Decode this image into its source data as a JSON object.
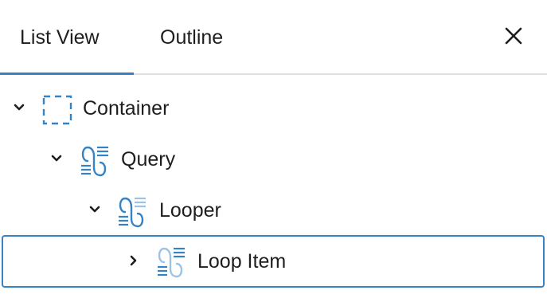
{
  "tabs": [
    {
      "label": "List View",
      "active": true
    },
    {
      "label": "Outline",
      "active": false
    }
  ],
  "colors": {
    "accent": "#3582c4",
    "icon_light": "#9ec2e6",
    "text": "#1e1e1e",
    "divider": "#e0e0e0"
  },
  "tree": [
    {
      "label": "Container",
      "icon": "container-icon",
      "expanded": true,
      "selected": false
    },
    {
      "label": "Query",
      "icon": "query-loop-icon",
      "expanded": true,
      "selected": false
    },
    {
      "label": "Looper",
      "icon": "query-loop-icon",
      "expanded": true,
      "selected": false
    },
    {
      "label": "Loop Item",
      "icon": "query-loop-icon",
      "expanded": false,
      "selected": true
    }
  ],
  "close_icon": "close-icon"
}
